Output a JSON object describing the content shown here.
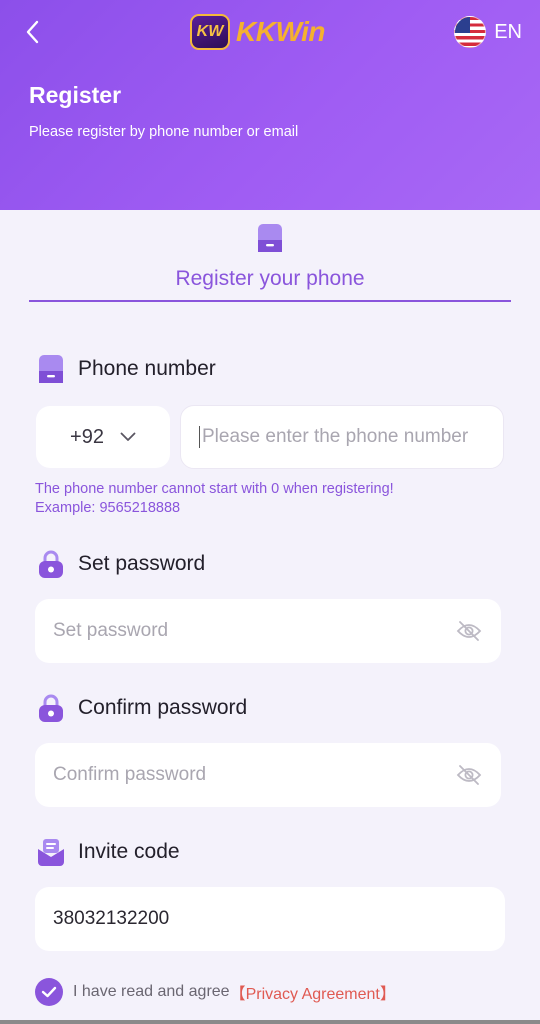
{
  "header": {
    "logo_badge": "KW",
    "logo_text": "KKWin",
    "language": "EN",
    "title": "Register",
    "subtitle": "Please register by phone number or email"
  },
  "tab": {
    "label": "Register your phone",
    "icon": "phone-icon"
  },
  "phone": {
    "label": "Phone number",
    "country_code": "+92",
    "placeholder": "Please enter the phone number",
    "value": "",
    "hint": [
      "The phone number cannot start with 0 when registering!",
      "Example: 9565218888"
    ]
  },
  "password": {
    "label": "Set password",
    "placeholder": "Set password"
  },
  "confirm": {
    "label": "Confirm password",
    "placeholder": "Confirm password"
  },
  "invite": {
    "label": "Invite code",
    "value": "38032132200"
  },
  "agreement": {
    "text": "I have read and agree",
    "link": "【Privacy Agreement】",
    "checked": true
  },
  "colors": {
    "accent": "#8a55dc",
    "header_gradient_start": "#8c4fea",
    "header_gradient_end": "#a868f5",
    "link": "#e05a52",
    "logo_gold": "#f5b12f"
  }
}
